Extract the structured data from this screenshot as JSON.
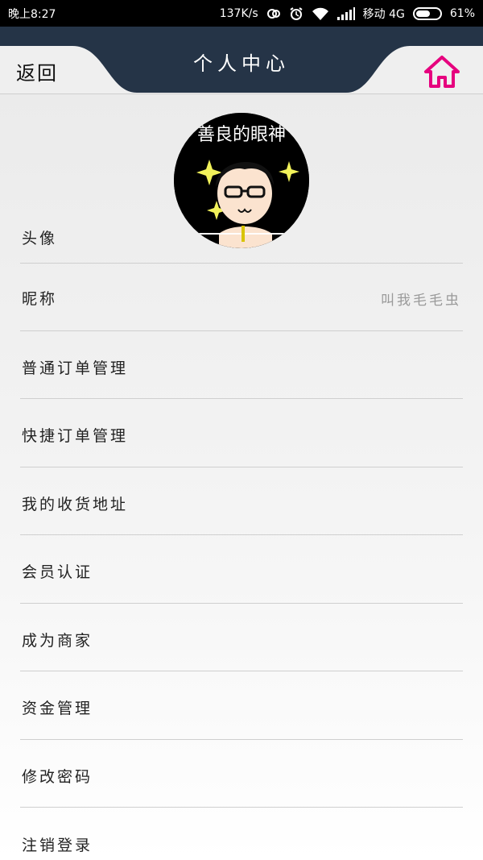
{
  "status_bar": {
    "time": "晚上8:27",
    "network_speed": "137K/s",
    "carrier": "移动 4G",
    "battery_percent": "61%",
    "battery_level": 0.61,
    "icons": [
      "sync-icon",
      "alarm-icon",
      "wifi-icon",
      "signal-icon",
      "battery-icon"
    ]
  },
  "header": {
    "back_label": "返回",
    "title": "个人中心",
    "home_icon": "home-icon",
    "colors": {
      "bar": "#253447",
      "home": "#e6007e"
    }
  },
  "profile": {
    "avatar_label": "头像",
    "avatar_caption": "善良的眼神",
    "nickname_label": "昵称",
    "nickname_value": "叫我毛毛虫"
  },
  "menu": {
    "items": [
      {
        "label": "普通订单管理"
      },
      {
        "label": "快捷订单管理"
      },
      {
        "label": "我的收货地址"
      },
      {
        "label": "会员认证"
      },
      {
        "label": "成为商家"
      },
      {
        "label": "资金管理"
      },
      {
        "label": "修改密码"
      },
      {
        "label": "注销登录"
      }
    ]
  }
}
